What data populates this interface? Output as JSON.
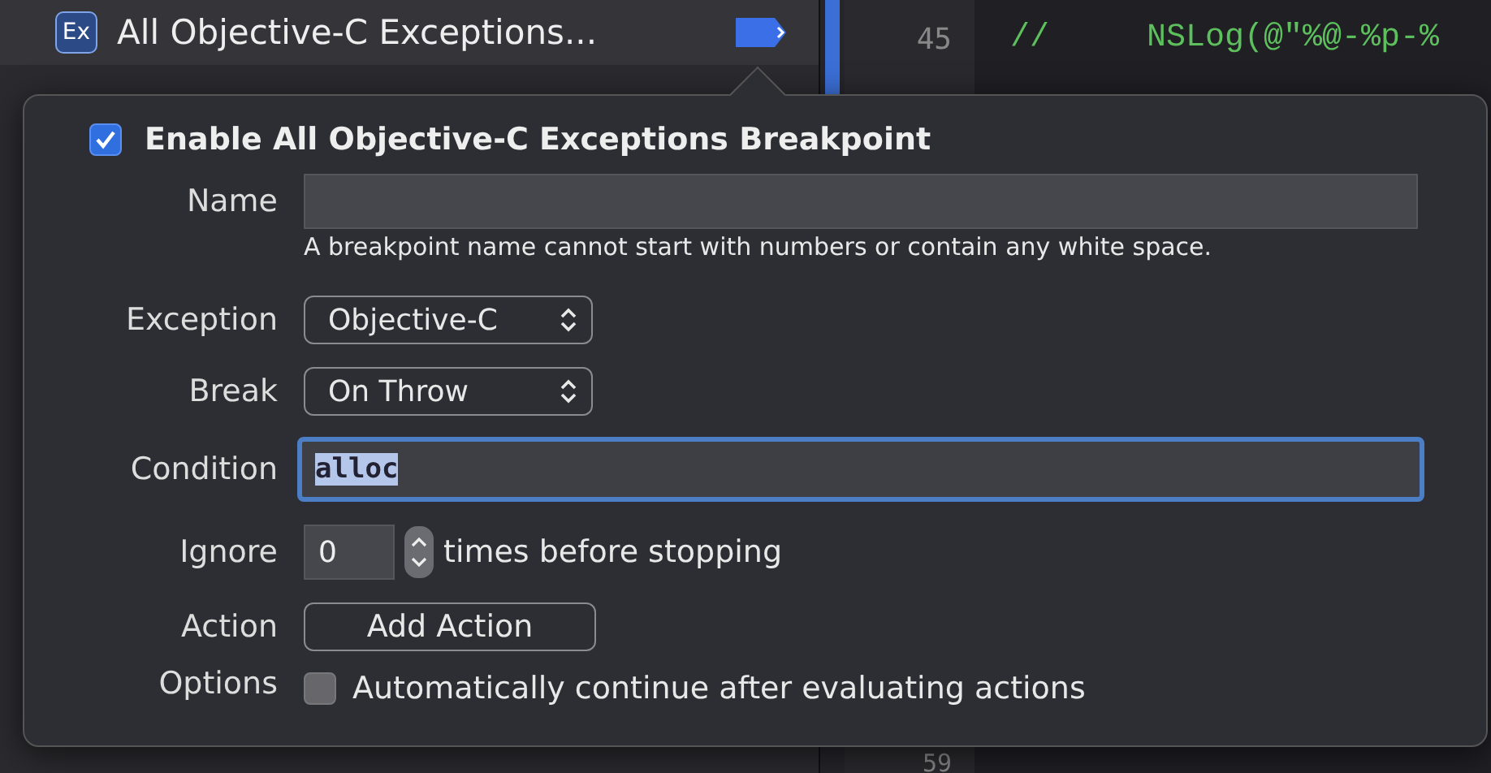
{
  "sidebar": {
    "breakpoint": {
      "badge": "Ex",
      "title": "All Objective-C Exceptions...",
      "enabled": true
    }
  },
  "editor": {
    "lines": [
      {
        "number": "45",
        "code": "//     NSLog(@\"%@-%p-%"
      },
      {
        "number": "59"
      }
    ]
  },
  "popover": {
    "enable": {
      "label": "Enable All Objective-C Exceptions Breakpoint",
      "checked": true
    },
    "name": {
      "label": "Name",
      "hint": "A breakpoint name cannot start with numbers or contain any white space."
    },
    "exception": {
      "label": "Exception",
      "value": "Objective-C"
    },
    "break": {
      "label": "Break",
      "value": "On Throw"
    },
    "condition": {
      "label": "Condition",
      "value": "alloc"
    },
    "ignore": {
      "label": "Ignore",
      "value": "0",
      "suffix": "times before stopping"
    },
    "action": {
      "label": "Action",
      "button": "Add Action"
    },
    "options": {
      "label": "Options",
      "checkbox": {
        "label": "Automatically continue after evaluating actions",
        "checked": false
      }
    }
  }
}
